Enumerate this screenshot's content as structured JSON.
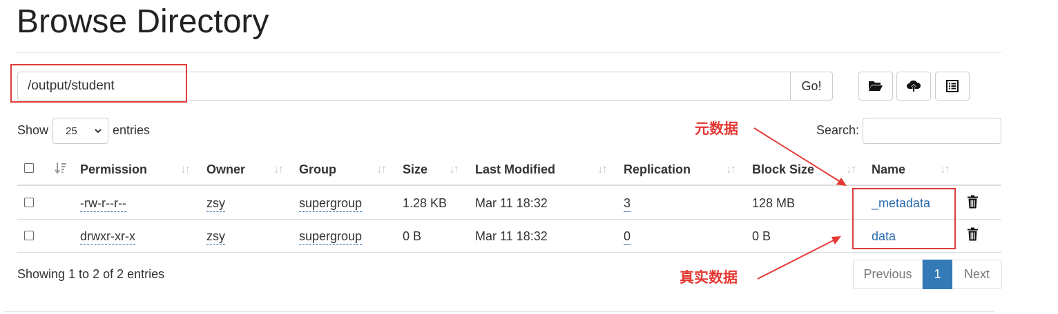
{
  "page": {
    "title": "Browse Directory"
  },
  "toolbar": {
    "path_value": "/output/student",
    "go_label": "Go!",
    "icons": [
      "folder-open-icon",
      "cloud-upload-icon",
      "list-icon"
    ]
  },
  "controls": {
    "show_label": "Show",
    "entries_value": "25",
    "entries_label": "entries",
    "search_label": "Search:",
    "search_value": ""
  },
  "table": {
    "headers": {
      "permission": "Permission",
      "owner": "Owner",
      "group": "Group",
      "size": "Size",
      "last_modified": "Last Modified",
      "replication": "Replication",
      "block_size": "Block Size",
      "name": "Name"
    },
    "rows": [
      {
        "permission": "-rw-r--r--",
        "owner": "zsy",
        "group": "supergroup",
        "size": "1.28 KB",
        "last_modified": "Mar 11 18:32",
        "replication": "3",
        "block_size": "128 MB",
        "name": "_metadata"
      },
      {
        "permission": "drwxr-xr-x",
        "owner": "zsy",
        "group": "supergroup",
        "size": "0 B",
        "last_modified": "Mar 11 18:32",
        "replication": "0",
        "block_size": "0 B",
        "name": "data"
      }
    ]
  },
  "footer": {
    "info": "Showing 1 to 2 of 2 entries",
    "pagination": {
      "previous": "Previous",
      "current": "1",
      "next": "Next"
    }
  },
  "annotations": {
    "metadata_label": "元数据",
    "real_data_label": "真实数据",
    "color": "#e53935"
  },
  "colors": {
    "link": "#2a6bb0",
    "active_page": "#337ab7"
  }
}
